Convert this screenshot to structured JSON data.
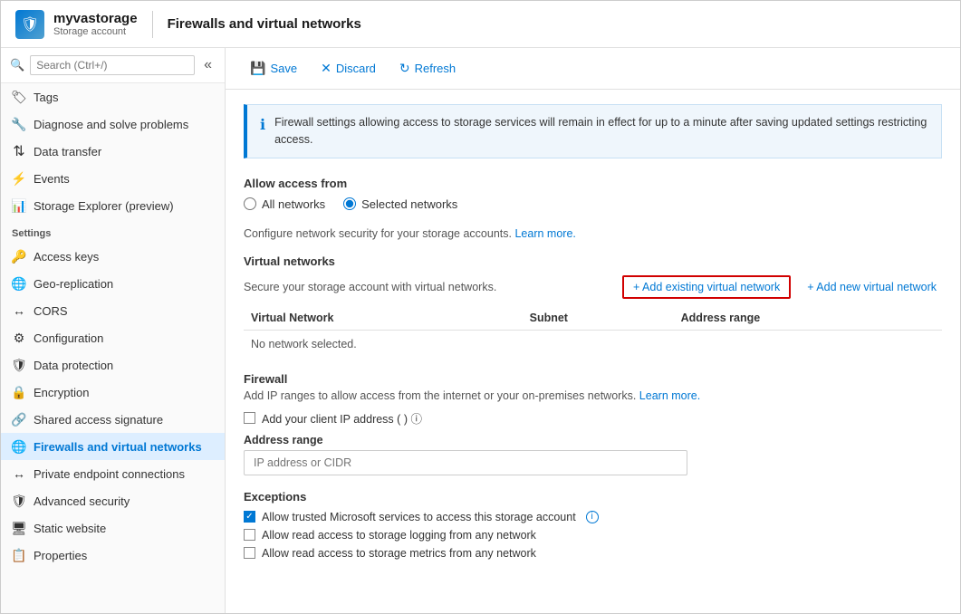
{
  "header": {
    "icon": "🛡",
    "resource_name": "myvastorage",
    "resource_type": "Storage account",
    "page_title": "Firewalls and virtual networks"
  },
  "search": {
    "placeholder": "Search (Ctrl+/)"
  },
  "sidebar": {
    "collapse_icon": "«",
    "items_top": [
      {
        "id": "tags",
        "label": "Tags",
        "icon": "🏷"
      },
      {
        "id": "diagnose",
        "label": "Diagnose and solve problems",
        "icon": "🔧"
      },
      {
        "id": "data-transfer",
        "label": "Data transfer",
        "icon": "↕"
      },
      {
        "id": "events",
        "label": "Events",
        "icon": "⚡"
      },
      {
        "id": "storage-explorer",
        "label": "Storage Explorer (preview)",
        "icon": "📊"
      }
    ],
    "settings_label": "Settings",
    "settings_items": [
      {
        "id": "access-keys",
        "label": "Access keys",
        "icon": "🔑"
      },
      {
        "id": "geo-replication",
        "label": "Geo-replication",
        "icon": "🌐"
      },
      {
        "id": "cors",
        "label": "CORS",
        "icon": "↔"
      },
      {
        "id": "configuration",
        "label": "Configuration",
        "icon": "⚙"
      },
      {
        "id": "data-protection",
        "label": "Data protection",
        "icon": "🛡"
      },
      {
        "id": "encryption",
        "label": "Encryption",
        "icon": "🔒"
      },
      {
        "id": "shared-access-signature",
        "label": "Shared access signature",
        "icon": "🔗"
      },
      {
        "id": "firewalls-virtual-networks",
        "label": "Firewalls and virtual networks",
        "icon": "🌐",
        "active": true
      },
      {
        "id": "private-endpoint",
        "label": "Private endpoint connections",
        "icon": "↔"
      },
      {
        "id": "advanced-security",
        "label": "Advanced security",
        "icon": "🛡"
      },
      {
        "id": "static-website",
        "label": "Static website",
        "icon": "🖥"
      },
      {
        "id": "properties",
        "label": "Properties",
        "icon": "📋"
      }
    ]
  },
  "toolbar": {
    "save_label": "Save",
    "discard_label": "Discard",
    "refresh_label": "Refresh"
  },
  "content": {
    "info_banner": "Firewall settings allowing access to storage services will remain in effect for up to a minute after saving updated settings restricting access.",
    "allow_access_label": "Allow access from",
    "radio_options": [
      {
        "id": "all-networks",
        "label": "All networks",
        "checked": false
      },
      {
        "id": "selected-networks",
        "label": "Selected networks",
        "checked": true
      }
    ],
    "configure_text": "Configure network security for your storage accounts.",
    "learn_more_label": "Learn more.",
    "virtual_networks": {
      "title": "Virtual networks",
      "description": "Secure your storage account with virtual networks.",
      "add_existing_label": "+ Add existing virtual network",
      "add_new_label": "+ Add new virtual network",
      "table_headers": [
        "Virtual Network",
        "Subnet",
        "Address range"
      ],
      "no_network_text": "No network selected."
    },
    "firewall": {
      "title": "Firewall",
      "description": "Add IP ranges to allow access from the internet or your on-premises networks.",
      "learn_more_label": "Learn more.",
      "client_ip_label": "Add your client IP address (",
      "client_ip_suffix": " ) ⓘ",
      "address_range_label": "Address range",
      "address_placeholder": "IP address or CIDR"
    },
    "exceptions": {
      "title": "Exceptions",
      "items": [
        {
          "id": "trusted-microsoft",
          "label": "Allow trusted Microsoft services to access this storage account",
          "checked": true,
          "has_info": true
        },
        {
          "id": "read-logging",
          "label": "Allow read access to storage logging from any network",
          "checked": false,
          "has_info": false
        },
        {
          "id": "read-metrics",
          "label": "Allow read access to storage metrics from any network",
          "checked": false,
          "has_info": false
        }
      ]
    }
  }
}
